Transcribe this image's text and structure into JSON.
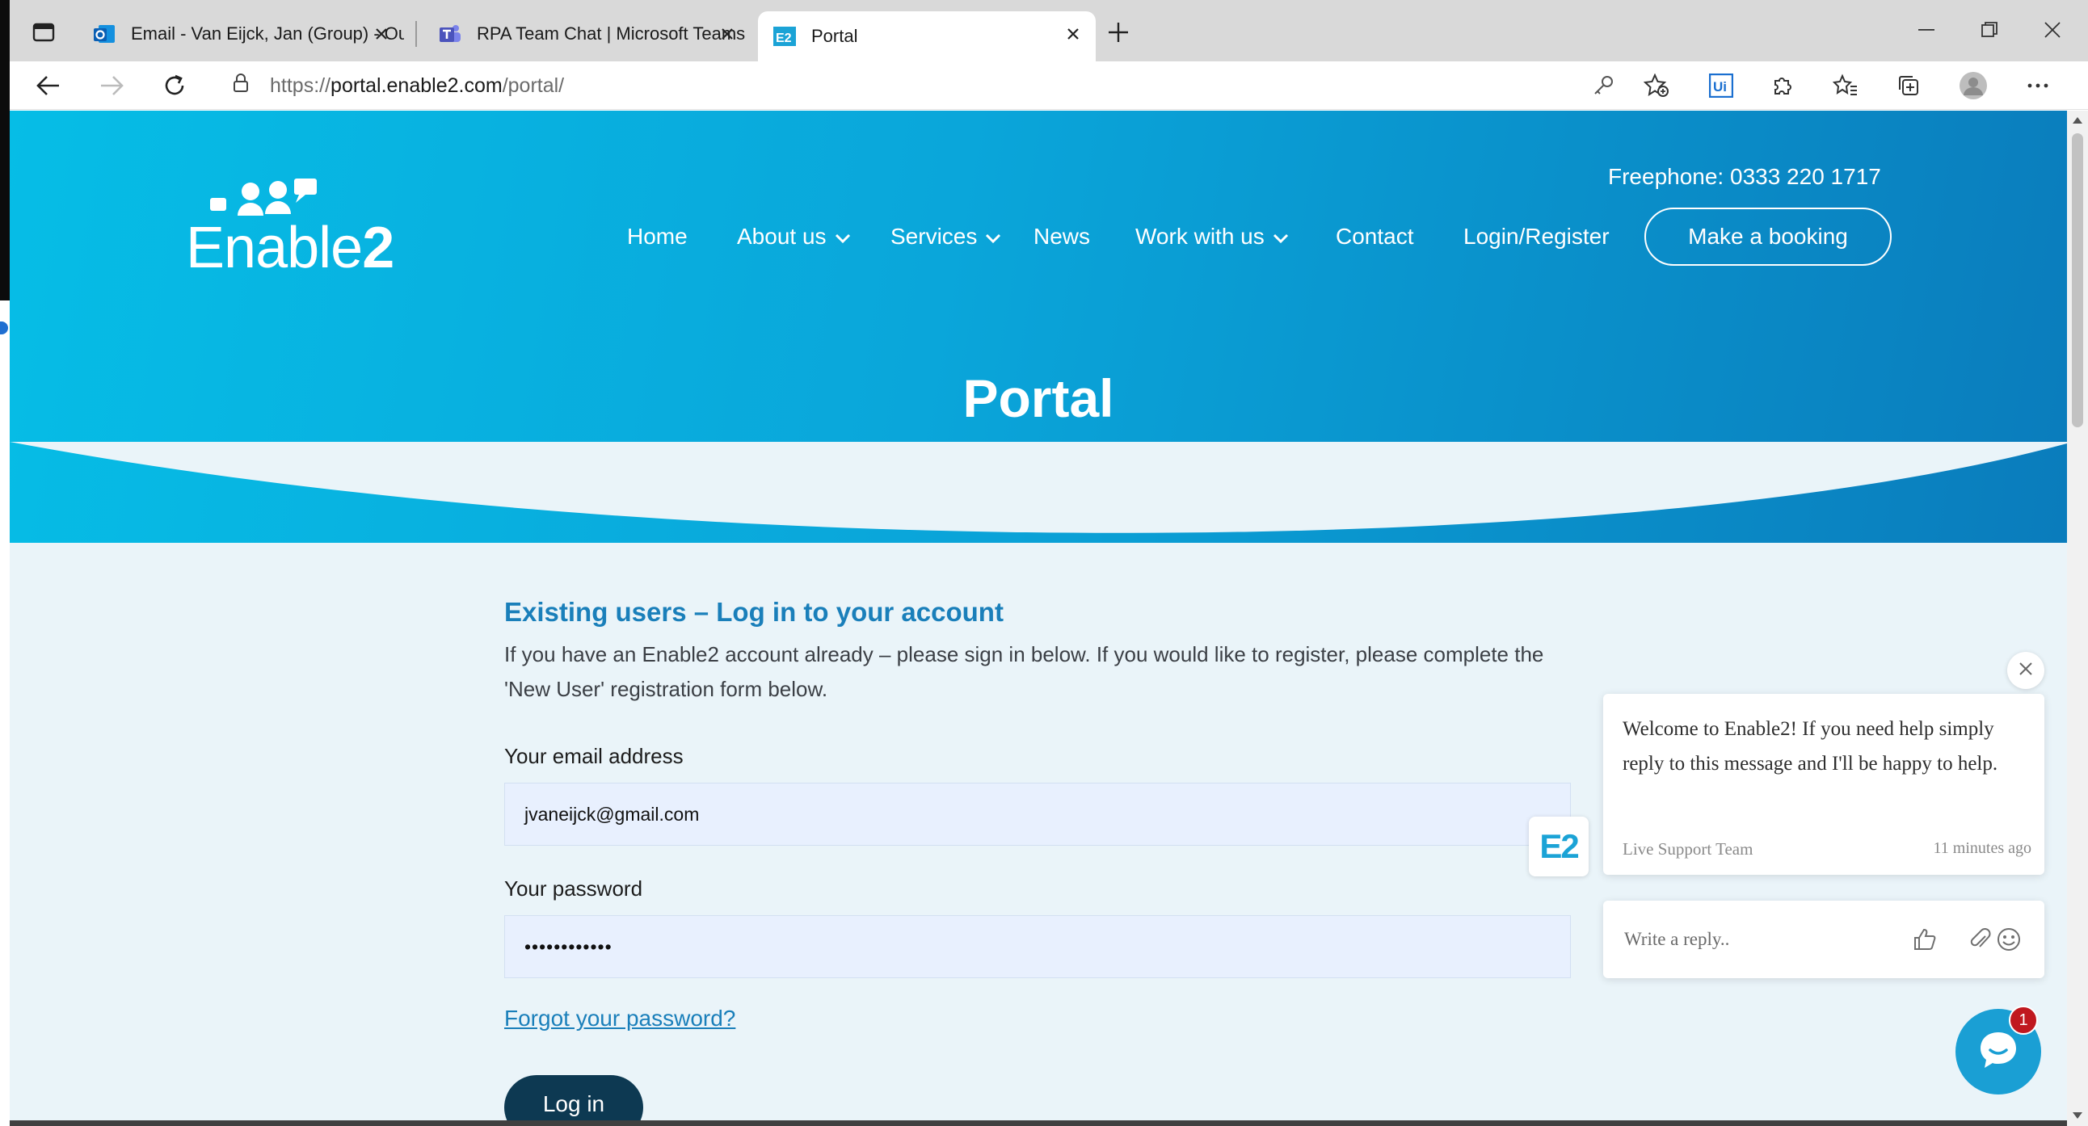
{
  "browser": {
    "tabs": [
      {
        "title": "Email - Van Eijck, Jan (Group) - Outlook",
        "icon": "outlook-icon"
      },
      {
        "title": "RPA Team Chat | Microsoft Teams",
        "icon": "teams-icon"
      },
      {
        "title": "Portal",
        "icon": "enable2-icon"
      }
    ],
    "url_prefix": "https://",
    "url_host": "portal.enable2.com",
    "url_path": "/portal/"
  },
  "site": {
    "logo_text_left": "Enable",
    "logo_text_right": "2",
    "freephone": "Freephone: 0333 220 1717",
    "nav": [
      "Home",
      "About us",
      "Services",
      "News",
      "Work with us",
      "Contact",
      "Login/Register"
    ],
    "booking_button": "Make a booking",
    "page_title": "Portal"
  },
  "login": {
    "heading": "Existing users – Log in to your account",
    "intro": "If you have an Enable2 account already – please sign in below. If you would like to register, please complete the 'New User' registration form below.",
    "email_label": "Your email address",
    "email_value": "jvaneijck@gmail.com",
    "password_label": "Your password",
    "password_value": "••••••••••••",
    "forgot_link": "Forgot your password?",
    "login_button": "Log in"
  },
  "chat": {
    "message": "Welcome to Enable2! If you need help simply reply to this message and I'll be happy to help.",
    "sender": "Live Support Team",
    "time": "11 minutes ago",
    "avatar_text": "E2",
    "reply_placeholder": "Write a reply..",
    "unread_count": "1"
  },
  "colors": {
    "hero_start": "#06bde6",
    "hero_end": "#0a7cbc",
    "accent": "#1a7fba",
    "login_button": "#0d3952",
    "badge": "#c0181f"
  }
}
